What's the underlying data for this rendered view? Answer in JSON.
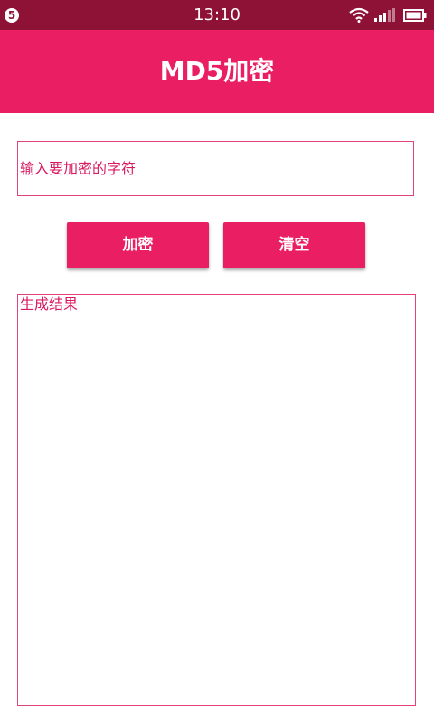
{
  "status_bar": {
    "notification_count": "5",
    "time": "13:10",
    "icons": [
      "wifi-icon",
      "signal-icon",
      "battery-icon"
    ]
  },
  "app_bar": {
    "title": "MD5加密"
  },
  "input": {
    "placeholder": "输入要加密的字符",
    "value": ""
  },
  "buttons": {
    "encrypt_label": "加密",
    "clear_label": "清空"
  },
  "result": {
    "label": "生成结果"
  },
  "colors": {
    "status_bar": "#8e1236",
    "primary": "#e91e63",
    "accent_text": "#d81b60",
    "border": "#e2447a"
  }
}
